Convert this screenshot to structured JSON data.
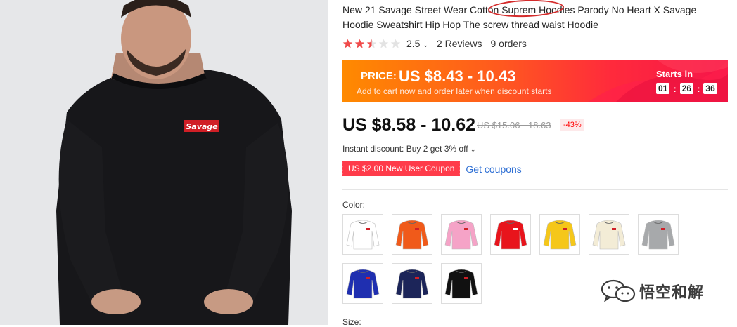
{
  "product": {
    "image_alt": "man wearing black Savage sweatshirt",
    "shirt_logo_text": "Savage",
    "title": "New 21 Savage Street Wear Cotton Suprem Hoodies Parody No Heart X Savage Hoodie Sweatshirt Hip Hop The screw thread waist Hoodie",
    "rating": {
      "stars": 2.5,
      "score_label": "2.5",
      "reviews_label": "2 Reviews",
      "orders_label": "9 orders"
    }
  },
  "promo": {
    "price_label": "PRICE:",
    "price_value": "US $8.43 - 10.43",
    "subtitle": "Add to cart now and order later when discount starts",
    "starts_label": "Starts in",
    "timer": [
      "01",
      "26",
      "36"
    ]
  },
  "pricing": {
    "current": "US $8.58 - 10.62",
    "original": "US $15.06 - 18.63",
    "discount": "-43%",
    "instant_discount": "Instant discount: Buy 2 get 3% off",
    "coupon": "US $2.00 New User Coupon",
    "get_coupons": "Get coupons"
  },
  "options": {
    "color_label": "Color:",
    "colors": [
      "#ffffff",
      "#f05a1a",
      "#f5a3c7",
      "#e8141c",
      "#f5c71a",
      "#f3ecd6",
      "#a7a9ab",
      "#1f2fb0",
      "#1c2559",
      "#111111"
    ],
    "size_label": "Size:"
  },
  "watermark": {
    "text": "悟空和解",
    "icon": "wechat-icon"
  }
}
